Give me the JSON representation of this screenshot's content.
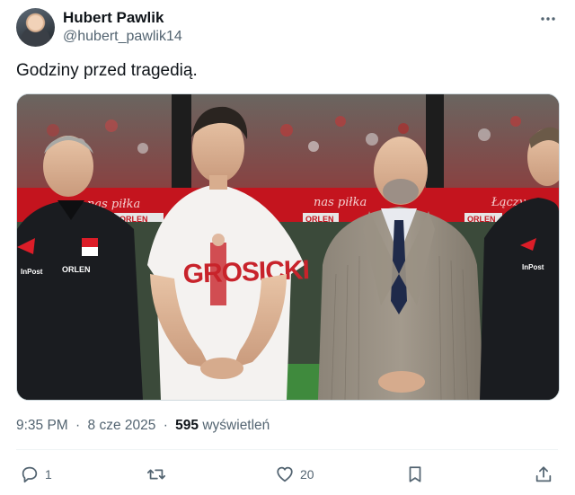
{
  "author": {
    "name": "Hubert Pawlik",
    "handle": "@hubert_pawlik14"
  },
  "tweet": {
    "text": "Godziny przed tragedią.",
    "time": "9:35 PM",
    "date": "8 cze 2025",
    "views_count": "595",
    "views_label": "wyświetleń",
    "separator": "·"
  },
  "media": {
    "board_texts": [
      "nas piłka",
      "nas piłka",
      "Łączy ns"
    ],
    "ad_text": "ORLEN",
    "jacket_brands": [
      "InPost",
      "ORLEN",
      "InPost"
    ],
    "shirt_print": "GROSICKI"
  },
  "actions": {
    "reply_count": "1",
    "retweet_count": "",
    "like_count": "20"
  },
  "icons": {
    "more": "more-icon",
    "reply": "reply-icon",
    "retweet": "retweet-icon",
    "like": "heart-icon",
    "bookmark": "bookmark-icon",
    "share": "share-icon"
  },
  "colors": {
    "text_primary": "#0f1419",
    "text_secondary": "#536471",
    "divider": "#eff3f4",
    "board_red": "#c4141e"
  }
}
